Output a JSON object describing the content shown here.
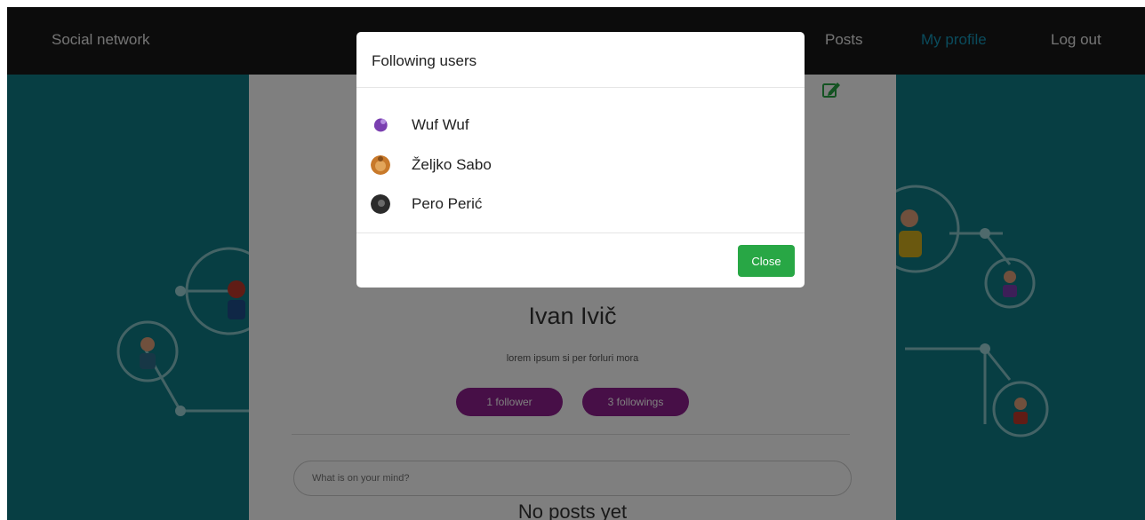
{
  "navbar": {
    "brand": "Social network",
    "links": [
      {
        "label": "Posts"
      },
      {
        "label": "My profile"
      },
      {
        "label": "Log out"
      }
    ],
    "active_color": "#1596b8"
  },
  "profile": {
    "name": "Ivan Ivič",
    "bio": "lorem ipsum si per forluri mora",
    "followers_label": "1 follower",
    "followings_label": "3 followings",
    "post_placeholder": "What is on your mind?",
    "empty_posts": "No posts yet",
    "edit_icon": "edit-icon"
  },
  "modal": {
    "title": "Following users",
    "users": [
      {
        "name": "Wuf Wuf",
        "avatar": "#7a3fb0"
      },
      {
        "name": "Željko Sabo",
        "avatar": "#c8792a"
      },
      {
        "name": "Pero Perić",
        "avatar": "#2b2b2b"
      }
    ],
    "close_label": "Close"
  },
  "colors": {
    "background": "#0e7c86",
    "navbar": "#191919",
    "pill": "#8e1f8e",
    "close_button": "#28a745"
  }
}
